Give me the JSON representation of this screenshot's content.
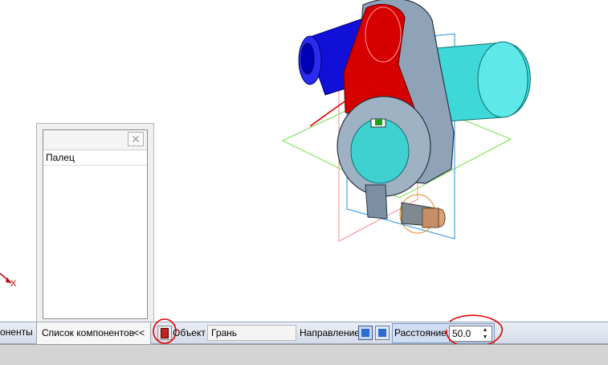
{
  "viewport": {
    "axis_x_label": "X",
    "icon": "3d-assembly-model"
  },
  "component_panel": {
    "close_icon": "close-icon",
    "items": [
      {
        "label": "Палец"
      }
    ]
  },
  "property_bar": {
    "left_tab_label": "оненты",
    "active_tab_label": "Список компонентов",
    "collapse_label": "<<",
    "pick_object_icon": "select-object-icon",
    "object_label": "Объект",
    "object_value": "Грань",
    "direction_label": "Направление",
    "direction_icons": [
      "direction-forward-icon",
      "direction-reverse-icon"
    ],
    "distance_label": "Расстояние",
    "distance_value": "50.0",
    "spin_up": "▲",
    "spin_down": "▼"
  },
  "colors": {
    "annotation": "#e00000",
    "accent": "#2c6bd1",
    "part_blue": "#1c1cf0",
    "part_cyan": "#3fd8d8",
    "part_red": "#d80000",
    "part_grey": "#8aa0b4"
  }
}
